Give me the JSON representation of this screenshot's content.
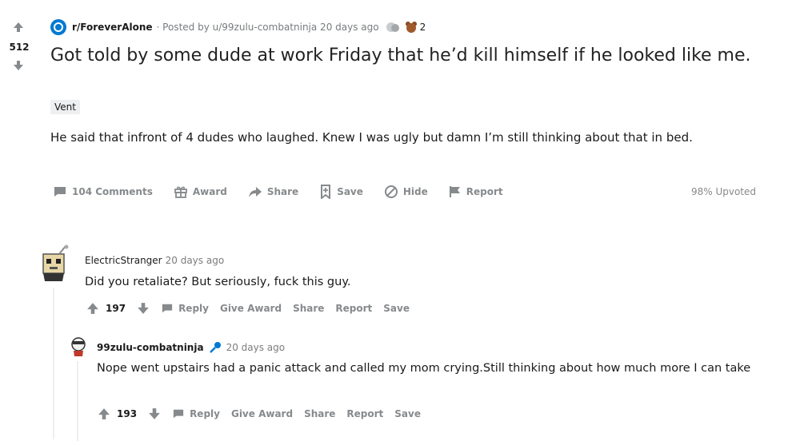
{
  "post": {
    "score": "512",
    "subreddit": "r/ForeverAlone",
    "posted_by": "· Posted by u/99zulu-combatninja 20 days ago",
    "award_count": "2",
    "title": "Got told by some dude at work Friday that he’d kill himself if he looked like me.",
    "flair": "Vent",
    "body": "He said that infront of 4 dudes who laughed. Knew I was ugly but damn I’m still thinking about that in bed.",
    "actions": {
      "comments": "104 Comments",
      "award": "Award",
      "share": "Share",
      "save": "Save",
      "hide": "Hide",
      "report": "Report"
    },
    "upvoted": "98% Upvoted"
  },
  "comments": [
    {
      "author": "ElectricStranger",
      "time": "20 days ago",
      "body": "Did you retaliate? But seriously, fuck this guy.",
      "score": "197",
      "reply": "Reply",
      "give_award": "Give Award",
      "share": "Share",
      "report": "Report",
      "save": "Save"
    },
    {
      "author": "99zulu-combatninja",
      "time": "20 days ago",
      "body": "Nope went upstairs had a panic attack and called my mom crying.Still thinking about how much more I can take",
      "score": "193",
      "reply": "Reply",
      "give_award": "Give Award",
      "share": "Share",
      "report": "Report",
      "save": "Save"
    }
  ],
  "colors": {
    "subreddit_icon": "#0079d3",
    "mic": "#0079d3",
    "action_gray": "#878a8c"
  }
}
